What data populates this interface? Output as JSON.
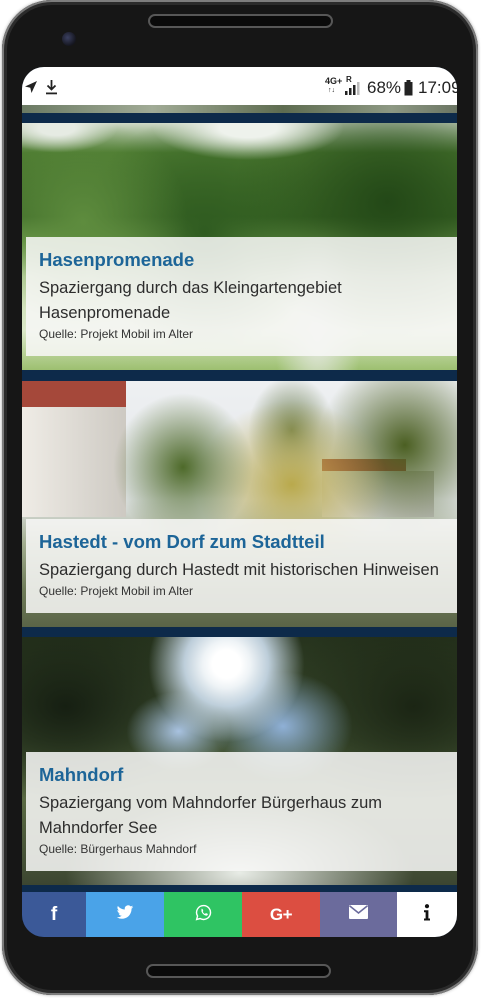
{
  "status_bar": {
    "network": "4G+",
    "roaming": "R",
    "battery": "68%",
    "time": "17:09",
    "icons": [
      "location-icon",
      "download-icon",
      "signal-icon",
      "battery-icon"
    ]
  },
  "walks": [
    {
      "title": "Hasenpromenade",
      "description": "Spaziergang durch das Kleingartengebiet Hasenpromenade",
      "source": "Quelle: Projekt Mobil im Alter"
    },
    {
      "title": "Hastedt - vom Dorf zum Stadtteil",
      "description": "Spaziergang durch Hastedt mit historischen Hinweisen",
      "source": "Quelle: Projekt Mobil im Alter"
    },
    {
      "title": "Mahndorf",
      "description": "Spaziergang vom Mahndorfer Bürgerhaus zum Mahndorfer See",
      "source": "Quelle: Bürgerhaus Mahndorf"
    }
  ],
  "share_bar": {
    "items": [
      {
        "icon": "facebook-icon",
        "label": "f",
        "color": "#3b5998"
      },
      {
        "icon": "twitter-icon",
        "color": "#4aa3e8"
      },
      {
        "icon": "whatsapp-icon",
        "color": "#2fc463"
      },
      {
        "icon": "google-plus-icon",
        "label": "G+",
        "color": "#dc4e41"
      },
      {
        "icon": "email-icon",
        "color": "#6b6b9c"
      },
      {
        "icon": "info-icon",
        "color": "#ffffff"
      }
    ]
  }
}
